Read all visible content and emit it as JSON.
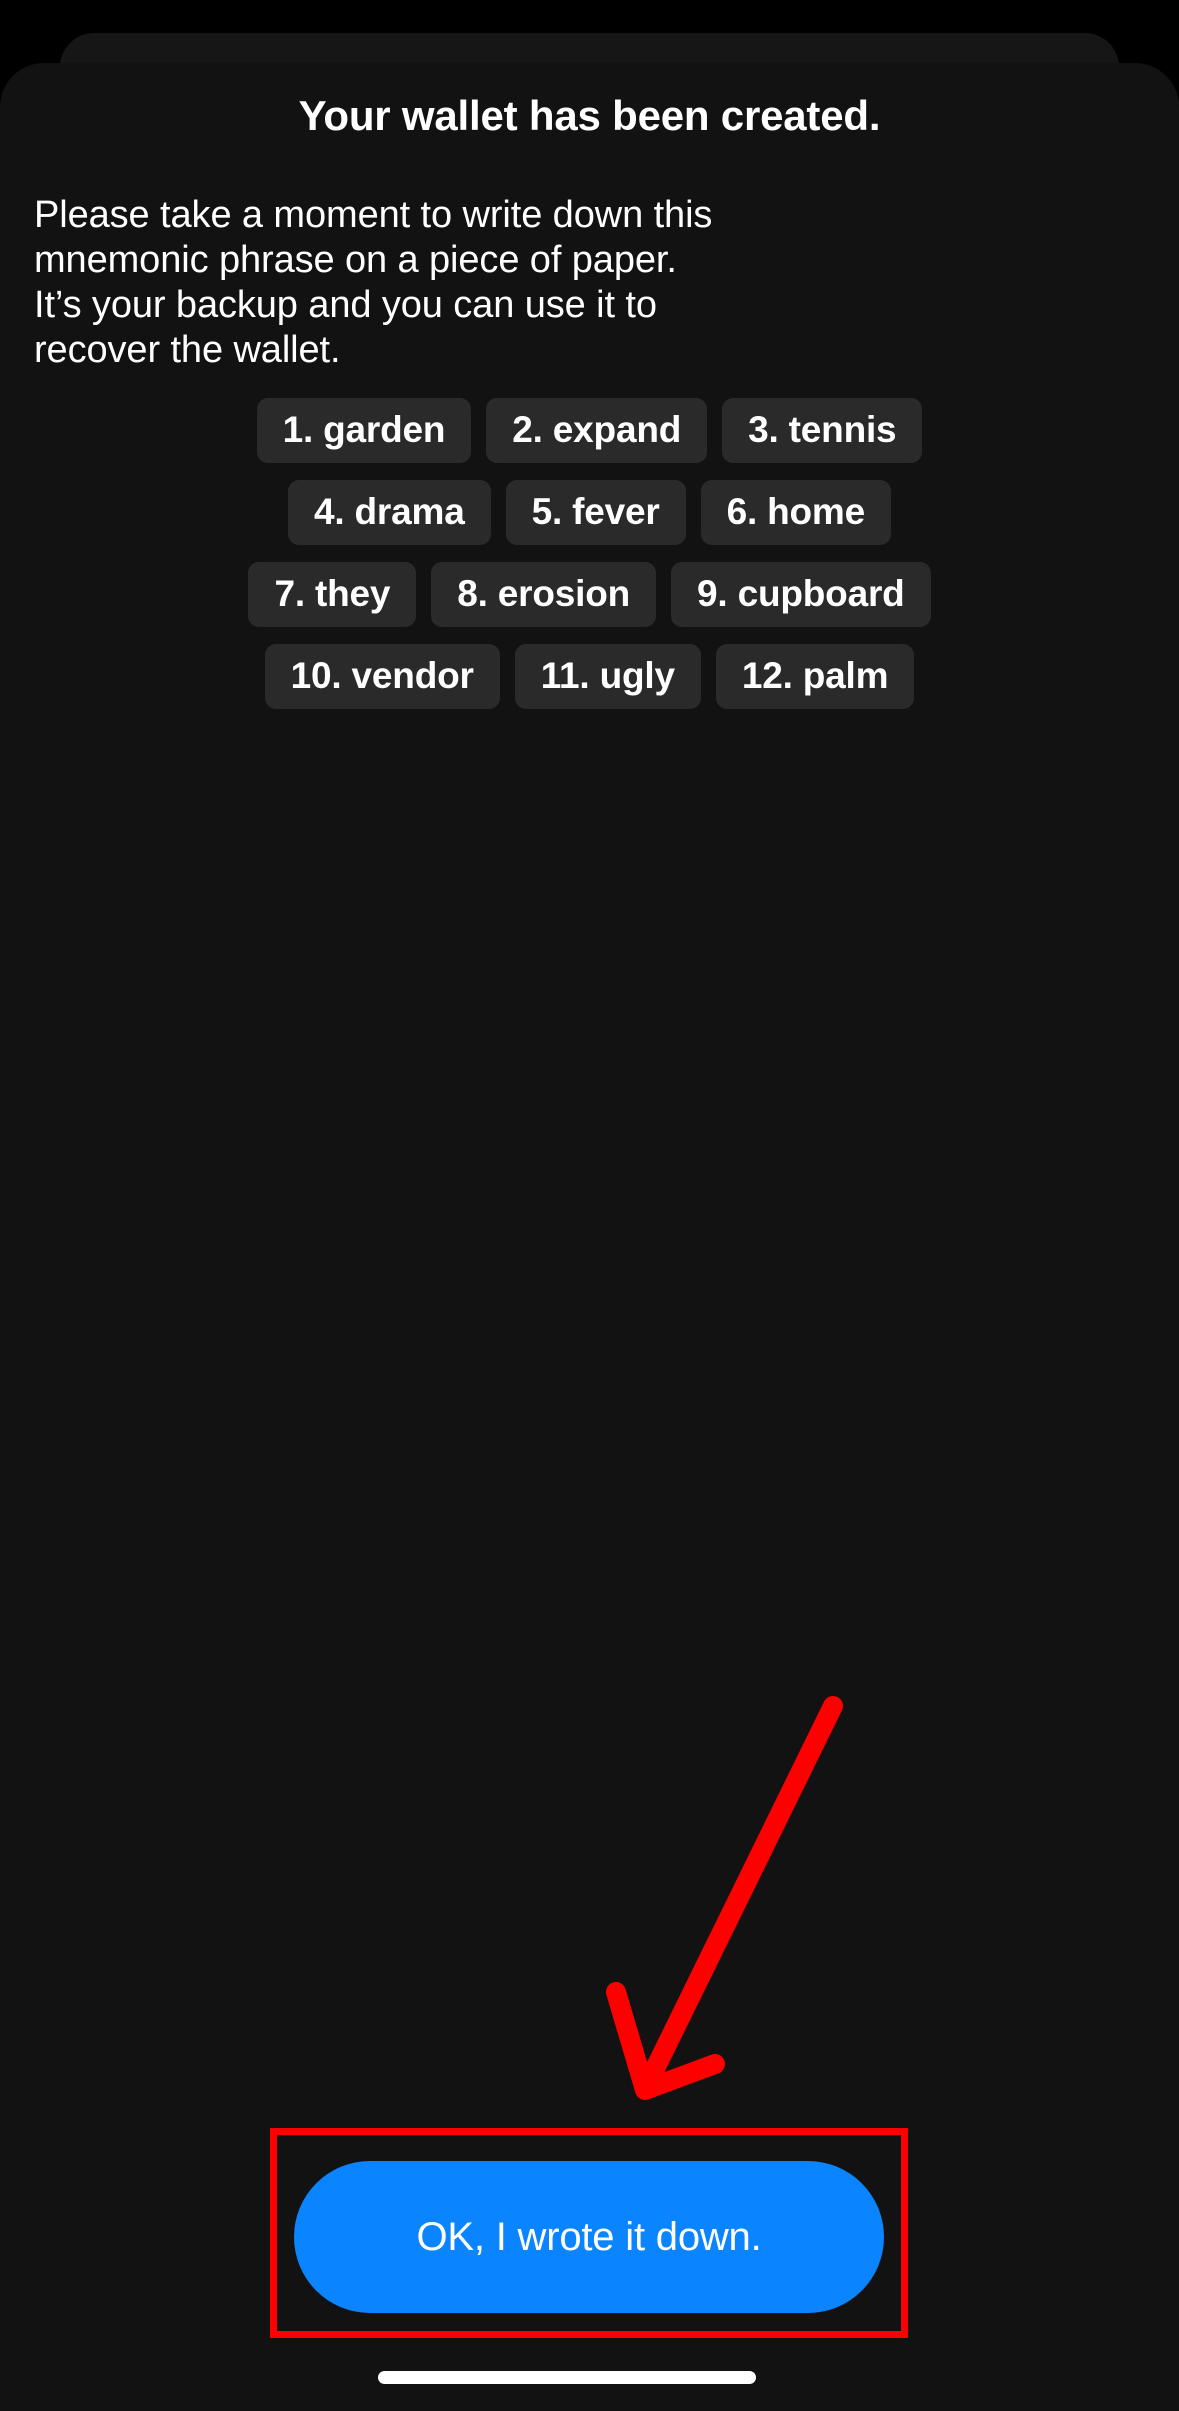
{
  "screen": {
    "background_color": "#000000",
    "sheet_color": "#121212",
    "sheet_back_color": "#161616"
  },
  "header": {
    "title": "Your wallet has been created."
  },
  "instructions": {
    "text": "Please take a moment to write down this mnemonic phrase on a piece of paper.\nIt’s your backup and you can use it to recover the wallet."
  },
  "mnemonic": {
    "chip_background": "#2a2a2a",
    "chip_text_color": "#ffffff",
    "rows": [
      [
        "1. garden",
        "2. expand",
        "3. tennis"
      ],
      [
        "4. drama",
        "5. fever",
        "6. home"
      ],
      [
        "7. they",
        "8. erosion",
        "9. cupboard"
      ],
      [
        "10. vendor",
        "11. ugly",
        "12. palm"
      ]
    ],
    "words": [
      {
        "index": 1,
        "word": "garden"
      },
      {
        "index": 2,
        "word": "expand"
      },
      {
        "index": 3,
        "word": "tennis"
      },
      {
        "index": 4,
        "word": "drama"
      },
      {
        "index": 5,
        "word": "fever"
      },
      {
        "index": 6,
        "word": "home"
      },
      {
        "index": 7,
        "word": "they"
      },
      {
        "index": 8,
        "word": "erosion"
      },
      {
        "index": 9,
        "word": "cupboard"
      },
      {
        "index": 10,
        "word": "vendor"
      },
      {
        "index": 11,
        "word": "ugly"
      },
      {
        "index": 12,
        "word": "palm"
      }
    ]
  },
  "primary_button": {
    "label": "OK, I wrote it down.",
    "color": "#0a84ff",
    "text_color": "#ffffff"
  },
  "annotations": {
    "highlight_color": "#ff0000",
    "arrow_color": "#ff0000"
  }
}
